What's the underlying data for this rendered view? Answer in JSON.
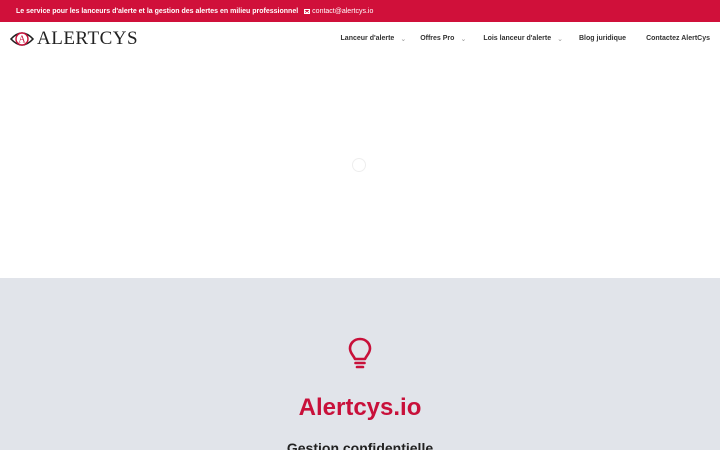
{
  "topbar": {
    "tagline": "Le service pour les lanceurs d'alerte et la gestion des alertes en milieu professionnel",
    "email": "contact@alertcys.io"
  },
  "header": {
    "logo_letter": "A",
    "logo_text": "ALERTCYS"
  },
  "nav": {
    "items": [
      {
        "label": "Lanceur d'alerte",
        "has_dropdown": true
      },
      {
        "label": "Offres Pro",
        "has_dropdown": true
      },
      {
        "label": "Lois lanceur d'alerte",
        "has_dropdown": true
      },
      {
        "label": "Blog juridique",
        "has_dropdown": false
      },
      {
        "label": "Contactez AlertCys",
        "has_dropdown": false
      }
    ],
    "chevron_glyph": "⌄"
  },
  "section": {
    "icon": "lightbulb-icon",
    "title": "Alertcys.io",
    "subtitle": "Gestion confidentielle"
  },
  "colors": {
    "brand": "#d0103a",
    "brand_text": "#c8103a",
    "section_bg": "#e1e4ea"
  }
}
